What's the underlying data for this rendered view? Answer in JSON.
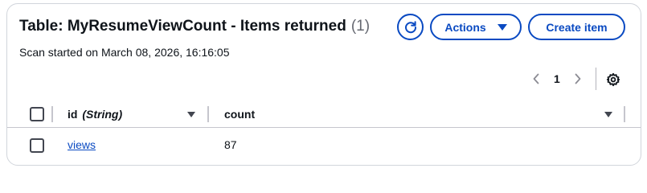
{
  "header": {
    "title": "Table: MyResumeViewCount - Items returned",
    "count": "(1)",
    "scan_status": "Scan started on March 08, 2026, 16:16:05"
  },
  "toolbar": {
    "refresh_icon": "refresh-icon",
    "actions_label": "Actions",
    "create_label": "Create item"
  },
  "pagination": {
    "current_page": "1",
    "prev_icon": "chevron-left-icon",
    "next_icon": "chevron-right-icon",
    "settings_icon": "gear-icon"
  },
  "table": {
    "columns": [
      {
        "name": "id",
        "type": "(String)"
      },
      {
        "name": "count",
        "type": ""
      }
    ],
    "rows": [
      {
        "id": "views",
        "count": "87"
      }
    ]
  },
  "colors": {
    "accent": "#0a4ac2",
    "text": "#0f141a",
    "muted": "#656871",
    "border": "#c6c6cd"
  }
}
